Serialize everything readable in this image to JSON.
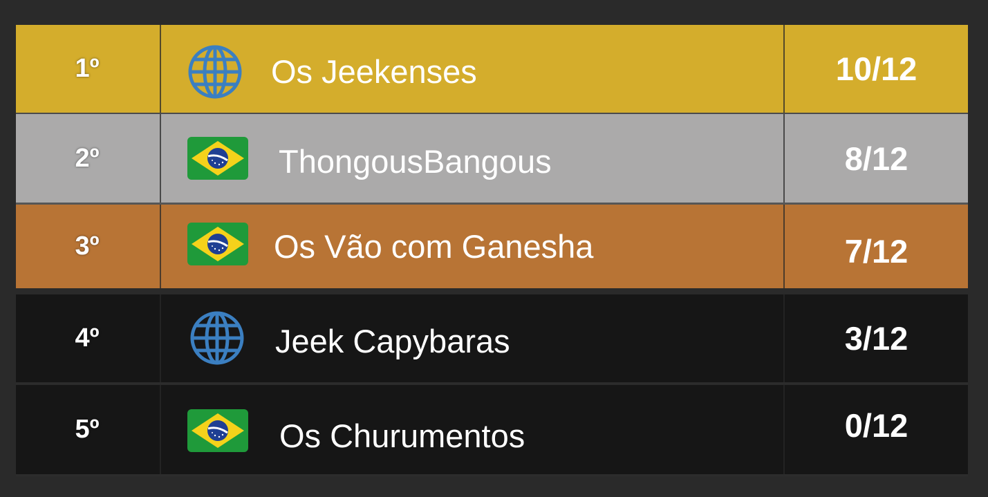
{
  "colors": {
    "gold": "#d4ad2c",
    "silver": "#abaaaa",
    "bronze": "#b87435",
    "dark": "#161616",
    "background": "#2a2a2a"
  },
  "rows": [
    {
      "rank": "1º",
      "flag": "globe-icon",
      "team": "Os Jeekenses",
      "score": "10/12"
    },
    {
      "rank": "2º",
      "flag": "brazil-flag-icon",
      "team": "ThongousBangous",
      "score": "8/12"
    },
    {
      "rank": "3º",
      "flag": "brazil-flag-icon",
      "team": "Os Vão com Ganesha",
      "score": "7/12"
    },
    {
      "rank": "4º",
      "flag": "globe-icon",
      "team": "Jeek Capybaras",
      "score": "3/12"
    },
    {
      "rank": "5º",
      "flag": "brazil-flag-icon",
      "team": "Os Churumentos",
      "score": "0/12"
    }
  ]
}
